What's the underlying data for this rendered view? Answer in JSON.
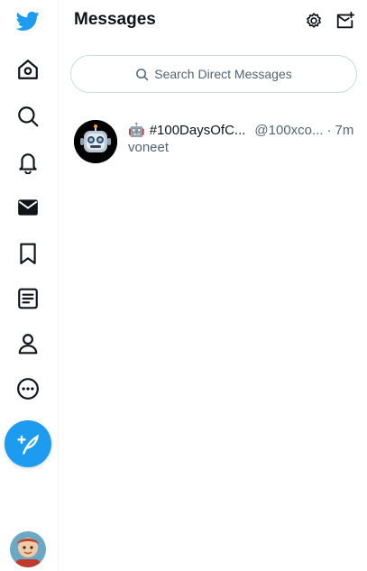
{
  "sidebar": {
    "items": [
      {
        "name": "home",
        "icon": "home-icon"
      },
      {
        "name": "explore",
        "icon": "search-icon"
      },
      {
        "name": "notifications",
        "icon": "bell-icon"
      },
      {
        "name": "messages",
        "icon": "envelope-icon"
      },
      {
        "name": "bookmarks",
        "icon": "bookmark-icon"
      },
      {
        "name": "lists",
        "icon": "list-icon"
      },
      {
        "name": "profile",
        "icon": "person-icon"
      },
      {
        "name": "more",
        "icon": "more-icon"
      }
    ],
    "tweet_button_icon": "feather-plus-icon",
    "brand_color": "#1d9bf0"
  },
  "header": {
    "title": "Messages",
    "settings_icon": "gear-icon",
    "new_message_icon": "new-message-icon"
  },
  "search": {
    "placeholder": "Search Direct Messages"
  },
  "conversations": [
    {
      "emoji": "🤖",
      "name": "#100DaysOfC...",
      "handle": "@100xco...",
      "separator": "·",
      "time": "7m",
      "preview": "voneet"
    }
  ]
}
